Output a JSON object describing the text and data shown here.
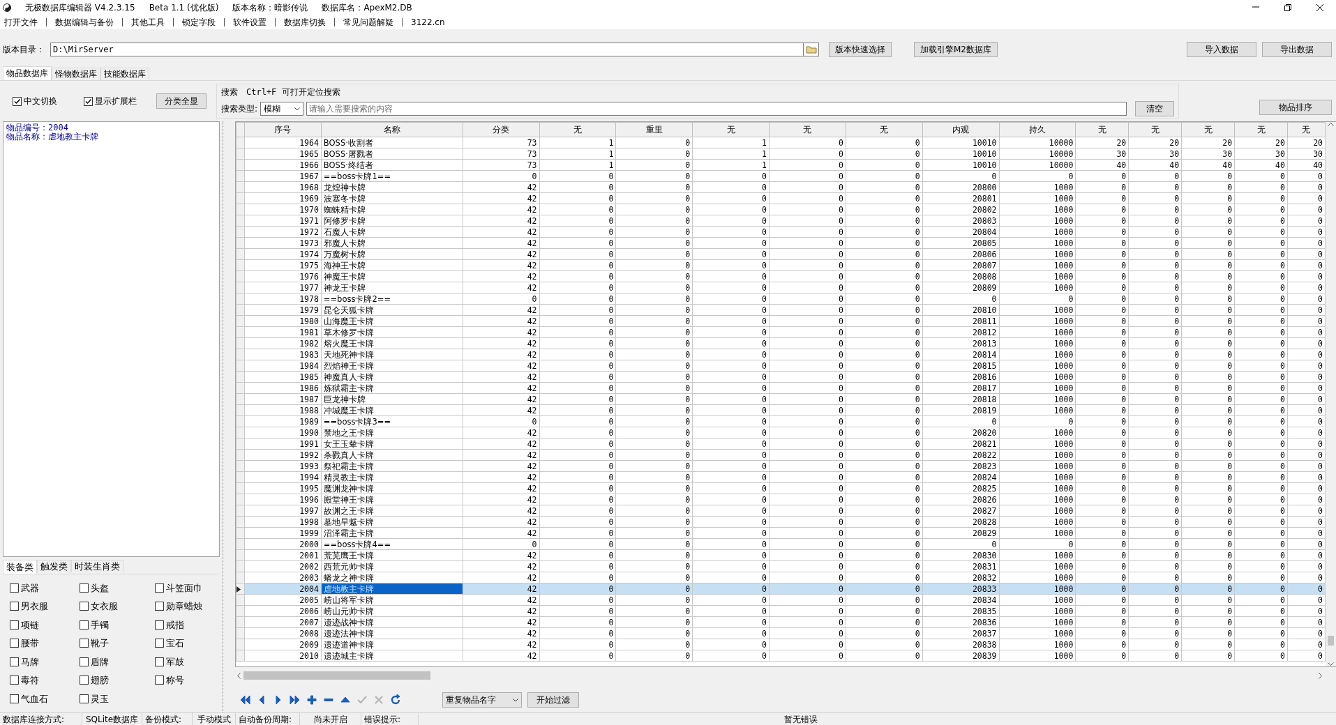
{
  "window": {
    "title_parts": [
      "无极数据库编辑器 V4.2.3.15",
      "Beta 1.1 (优化版)",
      "版本名称：暗影传说",
      "数据库名：ApexM2.DB"
    ]
  },
  "menu": [
    "打开文件",
    "数据编辑与备份",
    "其他工具",
    "锁定字段",
    "软件设置",
    "数据库切换",
    "常见问题解疑",
    "3122.cn"
  ],
  "path_bar": {
    "label": "版本目录：",
    "value": "D:\\MirServer",
    "buttons": [
      "版本快速选择",
      "加载引擎M2数据库"
    ]
  },
  "data_buttons": [
    "导入数据",
    "导出数据"
  ],
  "db_tabs": [
    {
      "label": "物品数据库",
      "selected": true
    },
    {
      "label": "怪物数据库",
      "selected": false
    },
    {
      "label": "技能数据库",
      "selected": false
    }
  ],
  "options": [
    {
      "label": "中文切换",
      "checked": true
    },
    {
      "label": "显示扩展栏",
      "checked": true
    }
  ],
  "show_all_button": "分类全显",
  "search": {
    "title": "搜索",
    "hint": "Ctrl+F 可打开定位搜索",
    "type_label": "搜索类型:",
    "type_value": "模糊",
    "placeholder": "请输入需要搜索的内容",
    "clear_button": "清空"
  },
  "sort_button": "物品排序",
  "info": [
    "物品编号：2004",
    "物品名称：虐地教主卡牌"
  ],
  "category_tabs": [
    {
      "label": "装备类",
      "selected": true
    },
    {
      "label": "触发类",
      "selected": false
    },
    {
      "label": "时装生肖类",
      "selected": false
    }
  ],
  "categories": [
    {
      "label": "武器",
      "checked": false
    },
    {
      "label": "头盔",
      "checked": false
    },
    {
      "label": "斗笠面巾",
      "checked": false
    },
    {
      "label": "男衣服",
      "checked": false
    },
    {
      "label": "女衣服",
      "checked": false
    },
    {
      "label": "勋章蜡烛",
      "checked": false
    },
    {
      "label": "项链",
      "checked": false
    },
    {
      "label": "手镯",
      "checked": false
    },
    {
      "label": "戒指",
      "checked": false
    },
    {
      "label": "腰带",
      "checked": false
    },
    {
      "label": "靴子",
      "checked": false
    },
    {
      "label": "宝石",
      "checked": false
    },
    {
      "label": "马牌",
      "checked": false
    },
    {
      "label": "盾牌",
      "checked": false
    },
    {
      "label": "军鼓",
      "checked": false
    },
    {
      "label": "毒符",
      "checked": false
    },
    {
      "label": "翅膀",
      "checked": false
    },
    {
      "label": "称号",
      "checked": false
    },
    {
      "label": "气血石",
      "checked": false
    },
    {
      "label": "灵玉",
      "checked": false
    }
  ],
  "table": {
    "columns": [
      "序号",
      "名称",
      "分类",
      "无",
      "重里",
      "无",
      "无",
      "无",
      "内观",
      "持久",
      "无",
      "无",
      "无",
      "无",
      "无"
    ],
    "rows": [
      {
        "cells": [
          "1964",
          "BOSS·收割者",
          "73",
          "1",
          "0",
          "1",
          "0",
          "0",
          "10010",
          "10000",
          "20",
          "20",
          "20",
          "20",
          "20"
        ],
        "selected": false
      },
      {
        "cells": [
          "1965",
          "BOSS·屠戮者",
          "73",
          "1",
          "0",
          "1",
          "0",
          "0",
          "10010",
          "10000",
          "30",
          "30",
          "30",
          "30",
          "30"
        ],
        "selected": false
      },
      {
        "cells": [
          "1966",
          "BOSS·终结者",
          "73",
          "1",
          "0",
          "1",
          "0",
          "0",
          "10010",
          "10000",
          "40",
          "40",
          "40",
          "40",
          "40"
        ],
        "selected": false
      },
      {
        "cells": [
          "1967",
          "==boss卡牌1==",
          "0",
          "0",
          "0",
          "0",
          "0",
          "0",
          "0",
          "0",
          "0",
          "0",
          "0",
          "0",
          "0"
        ],
        "selected": false
      },
      {
        "cells": [
          "1968",
          "龙煌神卡牌",
          "42",
          "0",
          "0",
          "0",
          "0",
          "0",
          "20800",
          "1000",
          "0",
          "0",
          "0",
          "0",
          "0"
        ],
        "selected": false
      },
      {
        "cells": [
          "1969",
          "波塞冬卡牌",
          "42",
          "0",
          "0",
          "0",
          "0",
          "0",
          "20801",
          "1000",
          "0",
          "0",
          "0",
          "0",
          "0"
        ],
        "selected": false
      },
      {
        "cells": [
          "1970",
          "蜘蛛精卡牌",
          "42",
          "0",
          "0",
          "0",
          "0",
          "0",
          "20802",
          "1000",
          "0",
          "0",
          "0",
          "0",
          "0"
        ],
        "selected": false
      },
      {
        "cells": [
          "1971",
          "阿修罗卡牌",
          "42",
          "0",
          "0",
          "0",
          "0",
          "0",
          "20803",
          "1000",
          "0",
          "0",
          "0",
          "0",
          "0"
        ],
        "selected": false
      },
      {
        "cells": [
          "1972",
          "石魔人卡牌",
          "42",
          "0",
          "0",
          "0",
          "0",
          "0",
          "20804",
          "1000",
          "0",
          "0",
          "0",
          "0",
          "0"
        ],
        "selected": false
      },
      {
        "cells": [
          "1973",
          "邪魔人卡牌",
          "42",
          "0",
          "0",
          "0",
          "0",
          "0",
          "20805",
          "1000",
          "0",
          "0",
          "0",
          "0",
          "0"
        ],
        "selected": false
      },
      {
        "cells": [
          "1974",
          "万魔树卡牌",
          "42",
          "0",
          "0",
          "0",
          "0",
          "0",
          "20806",
          "1000",
          "0",
          "0",
          "0",
          "0",
          "0"
        ],
        "selected": false
      },
      {
        "cells": [
          "1975",
          "海神王卡牌",
          "42",
          "0",
          "0",
          "0",
          "0",
          "0",
          "20807",
          "1000",
          "0",
          "0",
          "0",
          "0",
          "0"
        ],
        "selected": false
      },
      {
        "cells": [
          "1976",
          "神魔王卡牌",
          "42",
          "0",
          "0",
          "0",
          "0",
          "0",
          "20808",
          "1000",
          "0",
          "0",
          "0",
          "0",
          "0"
        ],
        "selected": false
      },
      {
        "cells": [
          "1977",
          "神龙王卡牌",
          "42",
          "0",
          "0",
          "0",
          "0",
          "0",
          "20809",
          "1000",
          "0",
          "0",
          "0",
          "0",
          "0"
        ],
        "selected": false
      },
      {
        "cells": [
          "1978",
          "==boss卡牌2==",
          "0",
          "0",
          "0",
          "0",
          "0",
          "0",
          "0",
          "0",
          "0",
          "0",
          "0",
          "0",
          "0"
        ],
        "selected": false
      },
      {
        "cells": [
          "1979",
          "昆仑天狐卡牌",
          "42",
          "0",
          "0",
          "0",
          "0",
          "0",
          "20810",
          "1000",
          "0",
          "0",
          "0",
          "0",
          "0"
        ],
        "selected": false
      },
      {
        "cells": [
          "1980",
          "山海魔王卡牌",
          "42",
          "0",
          "0",
          "0",
          "0",
          "0",
          "20811",
          "1000",
          "0",
          "0",
          "0",
          "0",
          "0"
        ],
        "selected": false
      },
      {
        "cells": [
          "1981",
          "草木修罗卡牌",
          "42",
          "0",
          "0",
          "0",
          "0",
          "0",
          "20812",
          "1000",
          "0",
          "0",
          "0",
          "0",
          "0"
        ],
        "selected": false
      },
      {
        "cells": [
          "1982",
          "熔火魔王卡牌",
          "42",
          "0",
          "0",
          "0",
          "0",
          "0",
          "20813",
          "1000",
          "0",
          "0",
          "0",
          "0",
          "0"
        ],
        "selected": false
      },
      {
        "cells": [
          "1983",
          "天地死神卡牌",
          "42",
          "0",
          "0",
          "0",
          "0",
          "0",
          "20814",
          "1000",
          "0",
          "0",
          "0",
          "0",
          "0"
        ],
        "selected": false
      },
      {
        "cells": [
          "1984",
          "烈焰神王卡牌",
          "42",
          "0",
          "0",
          "0",
          "0",
          "0",
          "20815",
          "1000",
          "0",
          "0",
          "0",
          "0",
          "0"
        ],
        "selected": false
      },
      {
        "cells": [
          "1985",
          "神魔真人卡牌",
          "42",
          "0",
          "0",
          "0",
          "0",
          "0",
          "20816",
          "1000",
          "0",
          "0",
          "0",
          "0",
          "0"
        ],
        "selected": false
      },
      {
        "cells": [
          "1986",
          "炼狱霸主卡牌",
          "42",
          "0",
          "0",
          "0",
          "0",
          "0",
          "20817",
          "1000",
          "0",
          "0",
          "0",
          "0",
          "0"
        ],
        "selected": false
      },
      {
        "cells": [
          "1987",
          "巨龙神卡牌",
          "42",
          "0",
          "0",
          "0",
          "0",
          "0",
          "20818",
          "1000",
          "0",
          "0",
          "0",
          "0",
          "0"
        ],
        "selected": false
      },
      {
        "cells": [
          "1988",
          "冲城魔王卡牌",
          "42",
          "0",
          "0",
          "0",
          "0",
          "0",
          "20819",
          "1000",
          "0",
          "0",
          "0",
          "0",
          "0"
        ],
        "selected": false
      },
      {
        "cells": [
          "1989",
          "==boss卡牌3==",
          "0",
          "0",
          "0",
          "0",
          "0",
          "0",
          "0",
          "0",
          "0",
          "0",
          "0",
          "0",
          "0"
        ],
        "selected": false
      },
      {
        "cells": [
          "1990",
          "禁地之王卡牌",
          "42",
          "0",
          "0",
          "0",
          "0",
          "0",
          "20820",
          "1000",
          "0",
          "0",
          "0",
          "0",
          "0"
        ],
        "selected": false
      },
      {
        "cells": [
          "1991",
          "女王玉辇卡牌",
          "42",
          "0",
          "0",
          "0",
          "0",
          "0",
          "20821",
          "1000",
          "0",
          "0",
          "0",
          "0",
          "0"
        ],
        "selected": false
      },
      {
        "cells": [
          "1992",
          "杀戮真人卡牌",
          "42",
          "0",
          "0",
          "0",
          "0",
          "0",
          "20822",
          "1000",
          "0",
          "0",
          "0",
          "0",
          "0"
        ],
        "selected": false
      },
      {
        "cells": [
          "1993",
          "祭祀霸主卡牌",
          "42",
          "0",
          "0",
          "0",
          "0",
          "0",
          "20823",
          "1000",
          "0",
          "0",
          "0",
          "0",
          "0"
        ],
        "selected": false
      },
      {
        "cells": [
          "1994",
          "精灵教主卡牌",
          "42",
          "0",
          "0",
          "0",
          "0",
          "0",
          "20824",
          "1000",
          "0",
          "0",
          "0",
          "0",
          "0"
        ],
        "selected": false
      },
      {
        "cells": [
          "1995",
          "魔渊龙神卡牌",
          "42",
          "0",
          "0",
          "0",
          "0",
          "0",
          "20825",
          "1000",
          "0",
          "0",
          "0",
          "0",
          "0"
        ],
        "selected": false
      },
      {
        "cells": [
          "1996",
          "殿堂神王卡牌",
          "42",
          "0",
          "0",
          "0",
          "0",
          "0",
          "20826",
          "1000",
          "0",
          "0",
          "0",
          "0",
          "0"
        ],
        "selected": false
      },
      {
        "cells": [
          "1997",
          "故渊之王卡牌",
          "42",
          "0",
          "0",
          "0",
          "0",
          "0",
          "20827",
          "1000",
          "0",
          "0",
          "0",
          "0",
          "0"
        ],
        "selected": false
      },
      {
        "cells": [
          "1998",
          "墓地旱魃卡牌",
          "42",
          "0",
          "0",
          "0",
          "0",
          "0",
          "20828",
          "1000",
          "0",
          "0",
          "0",
          "0",
          "0"
        ],
        "selected": false
      },
      {
        "cells": [
          "1999",
          "沼泽霸主卡牌",
          "42",
          "0",
          "0",
          "0",
          "0",
          "0",
          "20829",
          "1000",
          "0",
          "0",
          "0",
          "0",
          "0"
        ],
        "selected": false
      },
      {
        "cells": [
          "2000",
          "==boss卡牌4==",
          "0",
          "0",
          "0",
          "0",
          "0",
          "0",
          "0",
          "0",
          "0",
          "0",
          "0",
          "0",
          "0"
        ],
        "selected": false
      },
      {
        "cells": [
          "2001",
          "荒芜鹰王卡牌",
          "42",
          "0",
          "0",
          "0",
          "0",
          "0",
          "20830",
          "1000",
          "0",
          "0",
          "0",
          "0",
          "0"
        ],
        "selected": false
      },
      {
        "cells": [
          "2002",
          "西荒元帅卡牌",
          "42",
          "0",
          "0",
          "0",
          "0",
          "0",
          "20831",
          "1000",
          "0",
          "0",
          "0",
          "0",
          "0"
        ],
        "selected": false
      },
      {
        "cells": [
          "2003",
          "蟠龙之神卡牌",
          "42",
          "0",
          "0",
          "0",
          "0",
          "0",
          "20832",
          "1000",
          "0",
          "0",
          "0",
          "0",
          "0"
        ],
        "selected": false
      },
      {
        "cells": [
          "2004",
          "虐地教主卡牌",
          "42",
          "0",
          "0",
          "0",
          "0",
          "0",
          "20833",
          "1000",
          "0",
          "0",
          "0",
          "0",
          "0"
        ],
        "selected": true
      },
      {
        "cells": [
          "2005",
          "崂山将军卡牌",
          "42",
          "0",
          "0",
          "0",
          "0",
          "0",
          "20834",
          "1000",
          "0",
          "0",
          "0",
          "0",
          "0"
        ],
        "selected": false
      },
      {
        "cells": [
          "2006",
          "崂山元帅卡牌",
          "42",
          "0",
          "0",
          "0",
          "0",
          "0",
          "20835",
          "1000",
          "0",
          "0",
          "0",
          "0",
          "0"
        ],
        "selected": false
      },
      {
        "cells": [
          "2007",
          "遗迹战神卡牌",
          "42",
          "0",
          "0",
          "0",
          "0",
          "0",
          "20836",
          "1000",
          "0",
          "0",
          "0",
          "0",
          "0"
        ],
        "selected": false
      },
      {
        "cells": [
          "2008",
          "遗迹法神卡牌",
          "42",
          "0",
          "0",
          "0",
          "0",
          "0",
          "20837",
          "1000",
          "0",
          "0",
          "0",
          "0",
          "0"
        ],
        "selected": false
      },
      {
        "cells": [
          "2009",
          "遗迹道神卡牌",
          "42",
          "0",
          "0",
          "0",
          "0",
          "0",
          "20838",
          "1000",
          "0",
          "0",
          "0",
          "0",
          "0"
        ],
        "selected": false
      },
      {
        "cells": [
          "2010",
          "遗迹城主卡牌",
          "42",
          "0",
          "0",
          "0",
          "0",
          "0",
          "20839",
          "1000",
          "0",
          "0",
          "0",
          "0",
          "0"
        ],
        "selected": false
      }
    ]
  },
  "nav_buttons": [
    {
      "kind": "first",
      "disabled": false
    },
    {
      "kind": "prior",
      "disabled": false
    },
    {
      "kind": "next",
      "disabled": false
    },
    {
      "kind": "last",
      "disabled": false
    },
    {
      "kind": "insert",
      "disabled": false
    },
    {
      "kind": "delete",
      "disabled": false
    },
    {
      "kind": "edit",
      "disabled": false
    },
    {
      "kind": "post",
      "disabled": true
    },
    {
      "kind": "cancel",
      "disabled": true
    },
    {
      "kind": "refresh",
      "disabled": false
    }
  ],
  "filter": {
    "value": "重复物品名字",
    "button": "开始过滤"
  },
  "status_bar": [
    "数据库连接方式:",
    "SQLite数据库",
    "备份模式:",
    "手动模式",
    "自动备份周期:",
    "尚未开启",
    "错误提示:",
    "暂无错误"
  ]
}
